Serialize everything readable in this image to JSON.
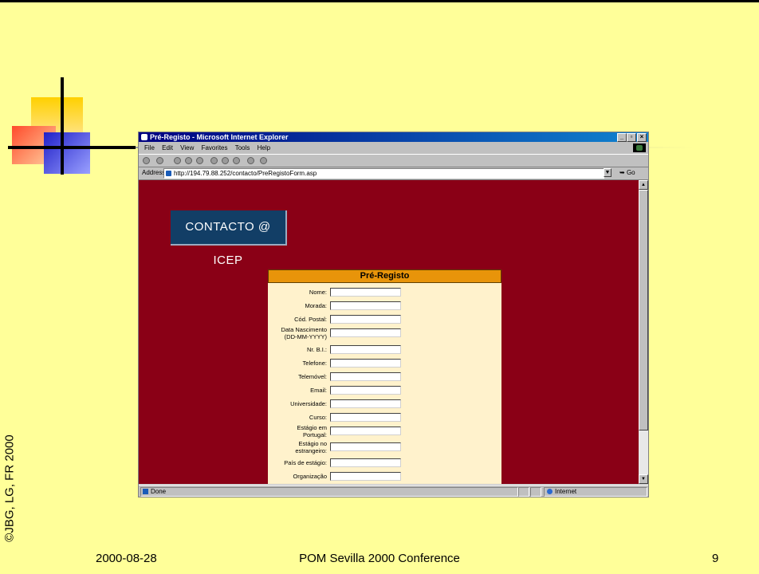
{
  "slide": {
    "footer_date": "2000-08-28",
    "footer_title": "POM Sevilla 2000 Conference",
    "page_number": "9",
    "copyright": "©JBG, LG, FR 2000"
  },
  "browser": {
    "title": "Pré-Registo - Microsoft Internet Explorer",
    "window_buttons": [
      "_",
      "▫",
      "×"
    ],
    "menu": [
      "File",
      "Edit",
      "View",
      "Favorites",
      "Tools",
      "Help"
    ],
    "address_label": "Address",
    "url": "http://194.79.88.252/contacto/PreRegistoForm.asp",
    "go_label": "Go",
    "status_text": "Done",
    "zone": "Internet"
  },
  "page": {
    "logo_text": "CONTACTO @ ICEP",
    "form_title": "Pré-Registo",
    "fields": [
      {
        "label": "Nome:",
        "value": ""
      },
      {
        "label": "Morada:",
        "value": ""
      },
      {
        "label": "Cód. Postal:",
        "value": ""
      },
      {
        "label": "Data Nascimento\n(DD-MM-YYYY)",
        "value": ""
      },
      {
        "label": "Nr. B.I.:",
        "value": ""
      },
      {
        "label": "Telefone:",
        "value": ""
      },
      {
        "label": "Telemóvel:",
        "value": ""
      },
      {
        "label": "Email:",
        "value": ""
      },
      {
        "label": "Universidade:",
        "value": ""
      },
      {
        "label": "Curso:",
        "value": ""
      },
      {
        "label": "Estágio em\nPortugal:",
        "value": ""
      },
      {
        "label": "Estágio no\nestrangeiro:",
        "value": ""
      },
      {
        "label": "País de estágio:",
        "value": ""
      },
      {
        "label": "Organização",
        "value": ""
      }
    ]
  },
  "colors": {
    "slide_bg": "#ffff99",
    "page_bg": "#8a0016",
    "form_bg": "#fff2cc",
    "form_header": "#e8940a",
    "logo_bg": "#123e66"
  }
}
